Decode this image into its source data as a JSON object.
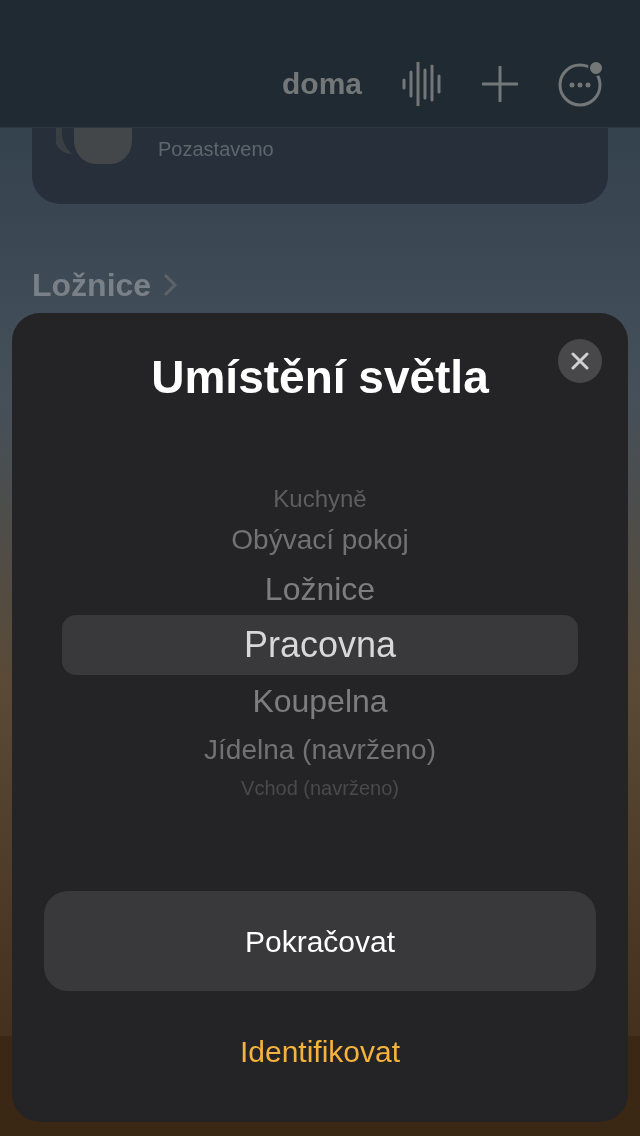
{
  "nav_bar": {
    "title": "doma"
  },
  "accessory_card": {
    "status": "Pozastaveno"
  },
  "section": {
    "title": "Ložnice"
  },
  "sheet": {
    "title": "Umístění světla",
    "picker": [
      {
        "label": "Kuchyně",
        "selected": false
      },
      {
        "label": "Obývací pokoj",
        "selected": false
      },
      {
        "label": "Ložnice",
        "selected": false
      },
      {
        "label": "Pracovna",
        "selected": true
      },
      {
        "label": "Koupelna",
        "selected": false
      },
      {
        "label": "Jídelna (navrženo)",
        "selected": false
      },
      {
        "label": "Vchod (navrženo)",
        "selected": false
      }
    ],
    "primary_button": "Pokračovat",
    "secondary_button": "Identifikovat"
  }
}
